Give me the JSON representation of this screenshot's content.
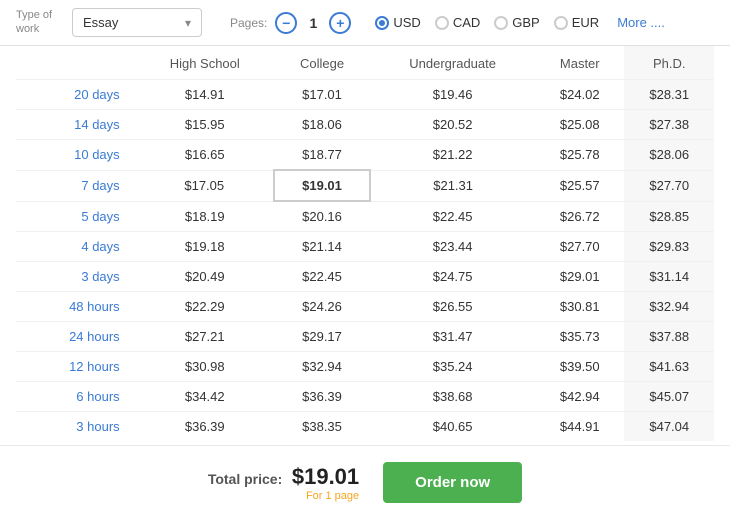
{
  "topBar": {
    "typeLabel": "Type of work",
    "workType": "Essay",
    "pagesLabel": "Pages:",
    "pageCount": "1",
    "decrementLabel": "−",
    "incrementLabel": "+",
    "currencies": [
      {
        "code": "USD",
        "selected": true
      },
      {
        "code": "CAD",
        "selected": false
      },
      {
        "code": "GBP",
        "selected": false
      },
      {
        "code": "EUR",
        "selected": false
      }
    ],
    "moreLabel": "More ...."
  },
  "table": {
    "headers": [
      "",
      "High School",
      "College",
      "Undergraduate",
      "Master",
      "Ph.D."
    ],
    "rows": [
      {
        "deadline": "20 days",
        "hs": "$14.91",
        "col": "$17.01",
        "ug": "$19.46",
        "ma": "$24.02",
        "phd": "$28.31"
      },
      {
        "deadline": "14 days",
        "hs": "$15.95",
        "col": "$18.06",
        "ug": "$20.52",
        "ma": "$25.08",
        "phd": "$27.38"
      },
      {
        "deadline": "10 days",
        "hs": "$16.65",
        "col": "$18.77",
        "ug": "$21.22",
        "ma": "$25.78",
        "phd": "$28.06"
      },
      {
        "deadline": "7 days",
        "hs": "$17.05",
        "col": "$19.01",
        "ug": "$21.31",
        "ma": "$25.57",
        "phd": "$27.70",
        "selected": "col"
      },
      {
        "deadline": "5 days",
        "hs": "$18.19",
        "col": "$20.16",
        "ug": "$22.45",
        "ma": "$26.72",
        "phd": "$28.85"
      },
      {
        "deadline": "4 days",
        "hs": "$19.18",
        "col": "$21.14",
        "ug": "$23.44",
        "ma": "$27.70",
        "phd": "$29.83"
      },
      {
        "deadline": "3 days",
        "hs": "$20.49",
        "col": "$22.45",
        "ug": "$24.75",
        "ma": "$29.01",
        "phd": "$31.14"
      },
      {
        "deadline": "48 hours",
        "hs": "$22.29",
        "col": "$24.26",
        "ug": "$26.55",
        "ma": "$30.81",
        "phd": "$32.94"
      },
      {
        "deadline": "24 hours",
        "hs": "$27.21",
        "col": "$29.17",
        "ug": "$31.47",
        "ma": "$35.73",
        "phd": "$37.88"
      },
      {
        "deadline": "12 hours",
        "hs": "$30.98",
        "col": "$32.94",
        "ug": "$35.24",
        "ma": "$39.50",
        "phd": "$41.63"
      },
      {
        "deadline": "6 hours",
        "hs": "$34.42",
        "col": "$36.39",
        "ug": "$38.68",
        "ma": "$42.94",
        "phd": "$45.07"
      },
      {
        "deadline": "3 hours",
        "hs": "$36.39",
        "col": "$38.35",
        "ug": "$40.65",
        "ma": "$44.91",
        "phd": "$47.04"
      }
    ]
  },
  "footer": {
    "totalLabel": "Total price:",
    "totalPrice": "$19.01",
    "totalSubtext": "For 1 page",
    "orderButtonLabel": "Order now"
  }
}
